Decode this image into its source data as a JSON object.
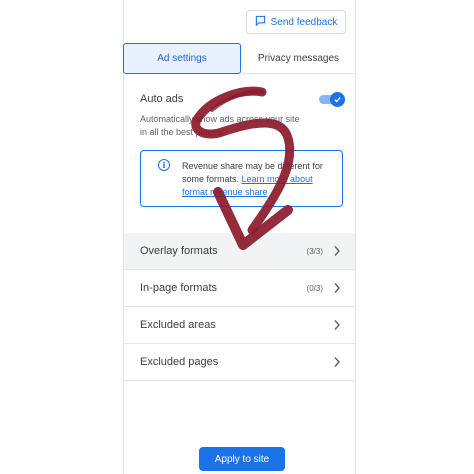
{
  "header": {
    "feedback_label": "Send feedback"
  },
  "tabs": [
    {
      "label": "Ad settings",
      "active": true
    },
    {
      "label": "Privacy messages",
      "active": false
    }
  ],
  "auto_ads": {
    "title": "Auto ads",
    "enabled": true,
    "description": "Automatically show ads across your site in all the best places"
  },
  "info": {
    "text": "Revenue share may be different for some formats.",
    "link_text": "Learn more about format revenue share"
  },
  "sections": [
    {
      "label": "Overlay formats",
      "count": "(3/3)"
    },
    {
      "label": "In-page formats",
      "count": "(0/3)"
    },
    {
      "label": "Excluded areas",
      "count": ""
    },
    {
      "label": "Excluded pages",
      "count": ""
    }
  ],
  "footer": {
    "apply_label": "Apply to site"
  },
  "colors": {
    "accent": "#1a73e8",
    "arrow": "#8b1a2b",
    "active_tab_bg": "#e8f0fe"
  },
  "icons": [
    "feedback-icon",
    "check-icon",
    "info-icon",
    "chevron-right-icon"
  ]
}
